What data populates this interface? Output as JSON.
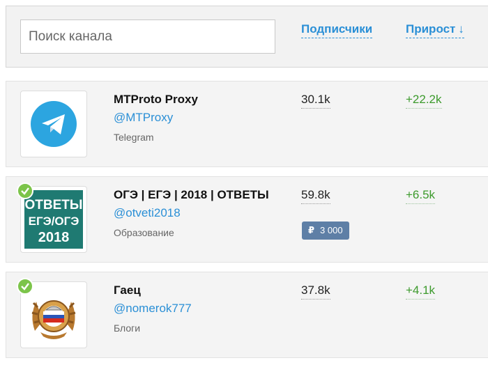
{
  "header": {
    "search_placeholder": "Поиск канала",
    "sort_subscribers_label": "Подписчики",
    "sort_growth_label": "Прирост",
    "sort_arrow": "↓"
  },
  "channels": [
    {
      "title": "MTProto Proxy",
      "handle": "@MTProxy",
      "category": "Telegram",
      "subscribers": "30.1k",
      "growth": "+22.2k",
      "verified": false
    },
    {
      "title": "ОГЭ | ЕГЭ | 2018 | ОТВЕТЫ",
      "handle": "@otveti2018",
      "category": "Образование",
      "subscribers": "59.8k",
      "growth": "+6.5k",
      "price_symbol": "₽",
      "price": "3 000",
      "verified": true,
      "avatar_text": [
        "ОТВЕТЫ",
        "ЕГЭ/ОГЭ",
        "2018"
      ]
    },
    {
      "title": "Гаец",
      "handle": "@nomerok777",
      "category": "Блоги",
      "subscribers": "37.8k",
      "growth": "+4.1k",
      "verified": true
    }
  ],
  "colors": {
    "link": "#2a8fd6",
    "growth": "#3c9a2c",
    "price_badge": "#5e7fa6",
    "verified": "#7cc44a",
    "telegram": "#2ca5e0",
    "avatar_teal": "#1f7a72"
  },
  "icons": {
    "channel_1": "telegram-logo-icon",
    "channel_2": "ege-answers-avatar",
    "channel_3": "police-emblem-avatar",
    "verified": "check-badge-icon"
  }
}
